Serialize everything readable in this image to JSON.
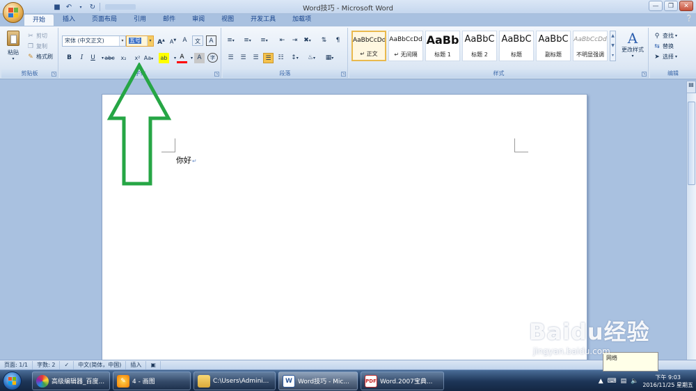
{
  "window": {
    "title": "Word技巧 - Microsoft Word"
  },
  "tabs": [
    "开始",
    "插入",
    "页面布局",
    "引用",
    "邮件",
    "审阅",
    "视图",
    "开发工具",
    "加载项"
  ],
  "clipboard": {
    "paste_label": "粘贴",
    "cut_label": "剪切",
    "copy_label": "复制",
    "format_painter_label": "格式刷",
    "group_label": "剪贴板"
  },
  "font": {
    "font_name": "宋体 (中文正文)",
    "font_size": "五号",
    "group_label": "字体",
    "bold": "B",
    "italic": "I",
    "underline": "U",
    "strike": "abc",
    "subscript": "x₂",
    "superscript": "x²",
    "change_case": "Aa",
    "grow": "A",
    "shrink": "A",
    "clear": "A",
    "phonetic": "文",
    "border_char": "A",
    "highlight": "ab",
    "font_color": "A",
    "shading": "A",
    "enclose": "字"
  },
  "paragraph": {
    "group_label": "段落"
  },
  "styles": {
    "group_label": "样式",
    "items": [
      {
        "sample": "AaBbCcDd",
        "name": "↵ 正文"
      },
      {
        "sample": "AaBbCcDd",
        "name": "↵ 无间隔"
      },
      {
        "sample": "AaBb",
        "name": "标题 1"
      },
      {
        "sample": "AaBbC",
        "name": "标题 2"
      },
      {
        "sample": "AaBbC",
        "name": "标题"
      },
      {
        "sample": "AaBbC",
        "name": "副标题"
      },
      {
        "sample": "AaBbCcDd",
        "name": "不明显强调"
      }
    ],
    "change_styles_label": "更改样式"
  },
  "editing": {
    "find_label": "查找",
    "replace_label": "替换",
    "select_label": "选择",
    "group_label": "编辑"
  },
  "document": {
    "text": "你好",
    "para_mark": "↵"
  },
  "status": {
    "page": "页面: 1/1",
    "words": "字数: 2",
    "language": "中文(简体，中国)",
    "insert": "插入"
  },
  "tooltip": {
    "line1": "网络"
  },
  "watermark": {
    "main": "Baidu经验",
    "sub": "jingyan.baidu.com"
  },
  "taskbar": {
    "items": [
      "高级编辑器_百度...",
      "4 - 画图",
      "C:\\Users\\Admini...",
      "Word技巧 - Mic...",
      "Word.2007宝典..."
    ],
    "time": "下午 9:03",
    "date": "2016/11/25 星期五"
  },
  "colors": {
    "arrow": "#26a645",
    "accent": "#15428b",
    "highlight_color": "#ffff00",
    "font_color": "#ff0000"
  }
}
